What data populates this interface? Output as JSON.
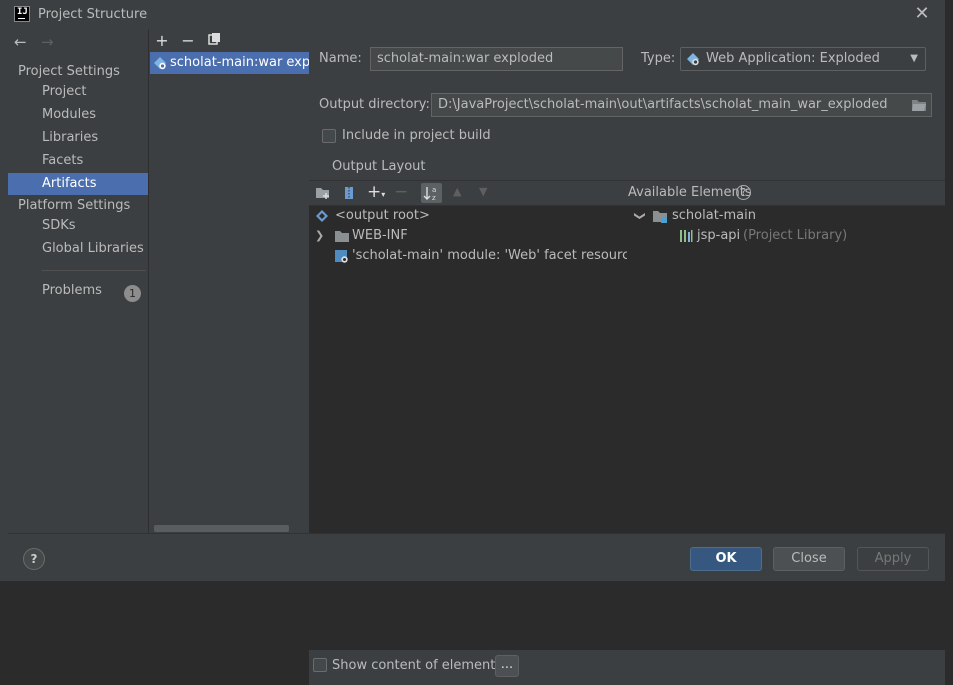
{
  "window": {
    "title": "Project Structure"
  },
  "sidebar": {
    "back": "←",
    "forward": "→",
    "project_settings_header": "Project Settings",
    "items": [
      {
        "label": "Project"
      },
      {
        "label": "Modules"
      },
      {
        "label": "Libraries"
      },
      {
        "label": "Facets"
      },
      {
        "label": "Artifacts",
        "selected": true
      }
    ],
    "platform_settings_header": "Platform Settings",
    "platform_items": [
      {
        "label": "SDKs"
      },
      {
        "label": "Global Libraries"
      }
    ],
    "problems": {
      "label": "Problems",
      "count": "1"
    }
  },
  "artifacts_list": {
    "toolbar": {
      "add": "+",
      "remove": "−",
      "copy": "⧉"
    },
    "items": [
      {
        "label": "scholat-main:war exploded"
      }
    ]
  },
  "editor": {
    "name_label": "Name:",
    "name_value": "scholat-main:war exploded",
    "type_label": "Type:",
    "type_value": "Web Application: Exploded",
    "output_dir_label": "Output directory:",
    "output_dir_value": "D:\\JavaProject\\scholat-main\\out\\artifacts\\scholat_main_war_exploded",
    "include_in_build_label": "Include in project build",
    "include_in_build_checked": false,
    "output_layout_tab": "Output Layout",
    "available_elements_label": "Available Elements",
    "output_tree": [
      {
        "label": "<output root>"
      },
      {
        "label": "WEB-INF"
      },
      {
        "label": "'scholat-main' module: 'Web' facet resources"
      }
    ],
    "available_tree": {
      "module": "scholat-main",
      "library": "jsp-api",
      "library_suffix": "(Project Library)"
    },
    "show_content_label": "Show content of elements",
    "show_content_checked": false,
    "more_button": "..."
  },
  "footer": {
    "help": "?",
    "ok": "OK",
    "close": "Close",
    "apply": "Apply"
  },
  "colors": {
    "background": "#3c3f41",
    "selection": "#4b6eaf",
    "tree_background": "#2b2b2b",
    "ok_button": "#365880"
  }
}
